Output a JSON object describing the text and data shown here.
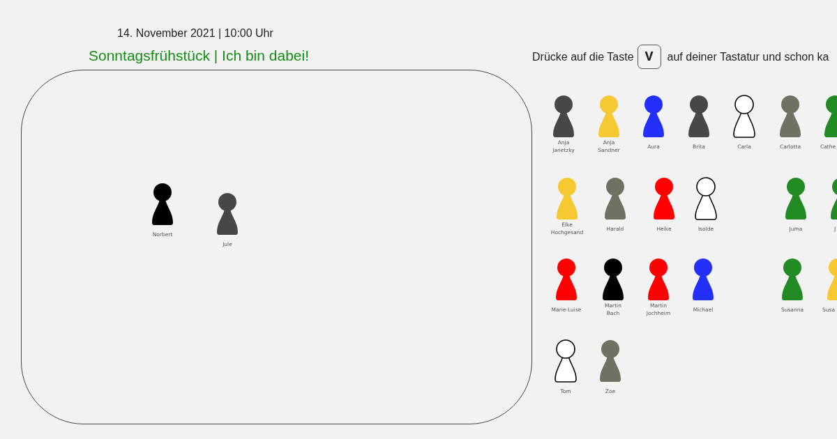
{
  "event": {
    "date": "14. November 2021 | 10:00 Uhr",
    "title": "Sonntagsfrühstück | Ich bin dabei!"
  },
  "board": {
    "pawns": [
      {
        "name": "Norbert",
        "color": "#000000"
      },
      {
        "name": "Jule",
        "color": "#474747"
      }
    ]
  },
  "instruction": {
    "before": "Drücke auf die Taste",
    "key": "V",
    "after": "auf deiner Tastatur und schon ka"
  },
  "waiting_pawns": [
    {
      "name": "Anja Janetzky",
      "color": "#474747"
    },
    {
      "name": "Anja Sandner",
      "color": "#f6c933"
    },
    {
      "name": "Aura",
      "color": "#2230fa"
    },
    {
      "name": "Brita",
      "color": "#474747"
    },
    {
      "name": "Carla",
      "color": "#ffffff"
    },
    {
      "name": "Carlotta",
      "color": "#6f7262"
    },
    {
      "name": "Cathe",
      "color": "#238b24"
    },
    {
      "name": "Elke Hochgesand",
      "color": "#f6c933"
    },
    {
      "name": "Harald",
      "color": "#6f7262"
    },
    {
      "name": "Heike",
      "color": "#ff0000"
    },
    {
      "name": "Isolde",
      "color": "#ffffff"
    },
    {
      "name": "Juma",
      "color": "#238b24"
    },
    {
      "name": "J",
      "color": "#238b24"
    },
    {
      "name": "Marie-Luise",
      "color": "#ff0000"
    },
    {
      "name": "Martin Bach",
      "color": "#000000"
    },
    {
      "name": "Martin Jochheim",
      "color": "#ff0000"
    },
    {
      "name": "Michael",
      "color": "#2230fa"
    },
    {
      "name": "Susanna",
      "color": "#238b24"
    },
    {
      "name": "Susa",
      "color": "#f6c933"
    },
    {
      "name": "Tom",
      "color": "#ffffff"
    },
    {
      "name": "Zoe",
      "color": "#6f7262"
    }
  ]
}
